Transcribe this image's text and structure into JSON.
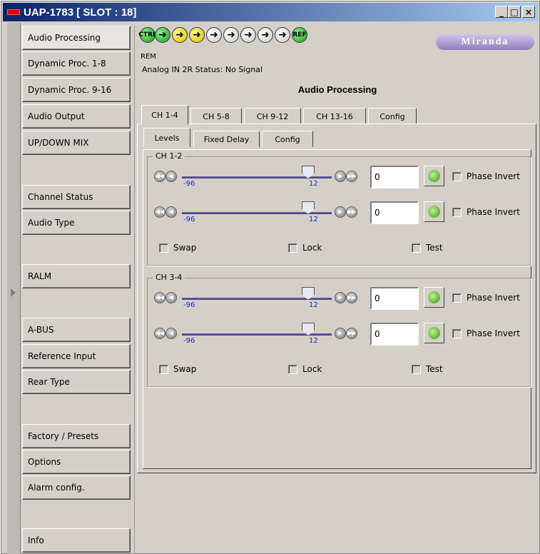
{
  "window": {
    "title": "UAP-1783 [ SLOT : 18]",
    "buttons": {
      "minimize": "_",
      "maximize": "□",
      "close": "×"
    }
  },
  "sidebar": {
    "items": [
      {
        "label": "Audio Processing",
        "active": true
      },
      {
        "label": "Dynamic Proc. 1-8"
      },
      {
        "label": "Dynamic Proc. 9-16"
      },
      {
        "label": "Audio Output"
      },
      {
        "label": "UP/DOWN MIX"
      },
      {
        "label": "Channel Status"
      },
      {
        "label": "Audio Type"
      },
      {
        "label": "RALM"
      },
      {
        "label": "A-BUS"
      },
      {
        "label": "Reference Input"
      },
      {
        "label": "Rear Type"
      },
      {
        "label": "Factory / Presets"
      },
      {
        "label": "Options"
      },
      {
        "label": "Alarm config."
      },
      {
        "label": "Info"
      }
    ]
  },
  "status_icons": {
    "ctrl": "CTRL",
    "ref": "REF",
    "arrow_colors": [
      "green",
      "yellow",
      "yellow",
      "white",
      "white",
      "white",
      "white",
      "white"
    ],
    "rem_label": "REM"
  },
  "brand": {
    "logo_text": "Miranda"
  },
  "status_line": "Analog IN 2R Status: No Signal",
  "panel": {
    "title": "Audio Processing",
    "tabs": [
      "CH 1-4",
      "CH 5-8",
      "CH 9-12",
      "CH 13-16",
      "Config"
    ],
    "active_tab": "CH 1-4",
    "subtabs": [
      "Levels",
      "Fixed Delay",
      "Config"
    ],
    "active_subtab": "Levels",
    "groups": [
      {
        "label": "CH 1-2",
        "channels": [
          {
            "min_label": "-96",
            "max_label": "12",
            "value": "0",
            "phase_label": "Phase Invert",
            "phase_checked": false
          },
          {
            "min_label": "-96",
            "max_label": "12",
            "value": "0",
            "phase_label": "Phase Invert",
            "phase_checked": false
          }
        ],
        "options": {
          "swap": "Swap",
          "lock": "Lock",
          "test": "Test"
        }
      },
      {
        "label": "CH 3-4",
        "channels": [
          {
            "min_label": "-96",
            "max_label": "12",
            "value": "0",
            "phase_label": "Phase Invert",
            "phase_checked": false
          },
          {
            "min_label": "-96",
            "max_label": "12",
            "value": "0",
            "phase_label": "Phase Invert",
            "phase_checked": false
          }
        ],
        "options": {
          "swap": "Swap",
          "lock": "Lock",
          "test": "Test"
        }
      }
    ]
  }
}
